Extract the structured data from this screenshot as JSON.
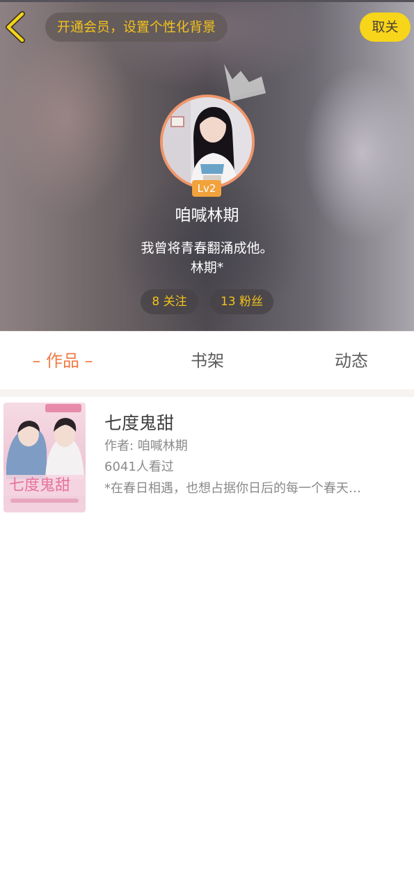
{
  "header": {
    "vip_banner": "开通会员，设置个性化背景",
    "unfollow_label": "取关",
    "back_icon": "chevron-left-icon",
    "crown_icon": "crown-icon"
  },
  "profile": {
    "level": "Lv2",
    "username": "咱喊林期",
    "bio_line1": "我曾将青春翻涌成他。",
    "bio_line2": "林期*",
    "following": "8 关注",
    "fans": "13 粉丝"
  },
  "tabs": [
    {
      "label": "– 作品 –",
      "active": true
    },
    {
      "label": "书架",
      "active": false
    },
    {
      "label": "动态",
      "active": false
    }
  ],
  "works": [
    {
      "title": "七度鬼甜",
      "author": "作者: 咱喊林期",
      "views": "6041人看过",
      "description": "*在春日相遇，也想占据你日后的每一个春天…"
    }
  ],
  "colors": {
    "accent_orange": "#f07a45",
    "vip_yellow": "#f2c21b",
    "button_yellow": "#f7d51a",
    "level_badge": "#f1a23c",
    "avatar_border": "#f0966b"
  }
}
